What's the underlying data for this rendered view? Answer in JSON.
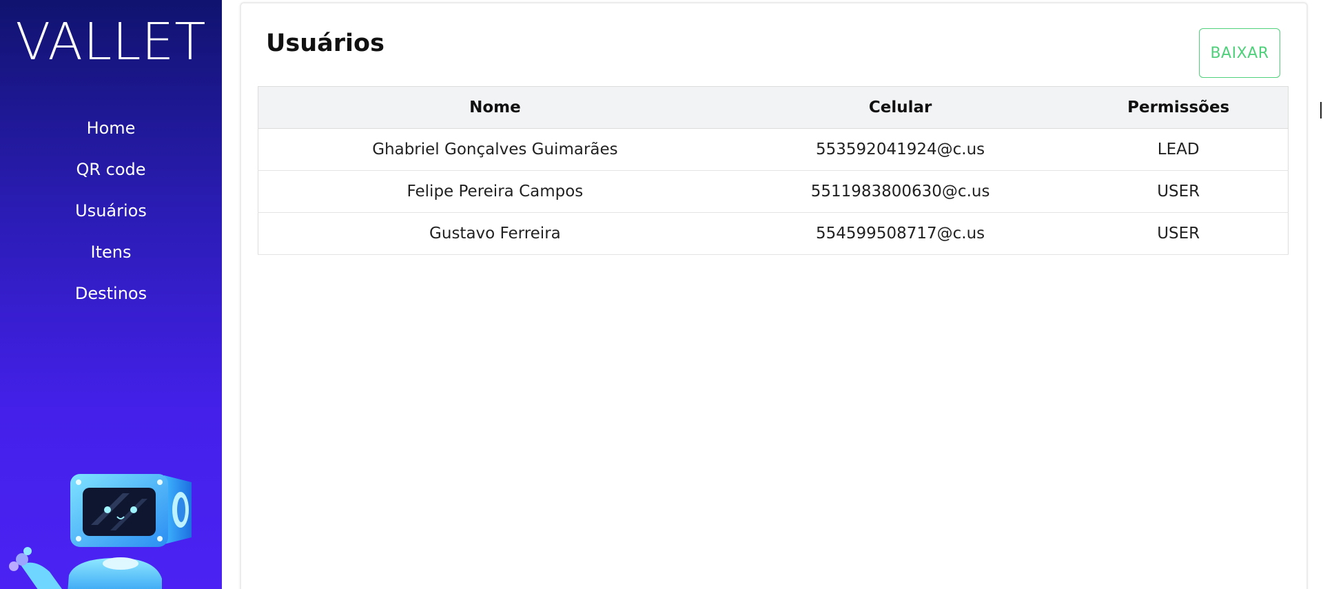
{
  "sidebar": {
    "brand": "VALLET",
    "nav": [
      {
        "label": "Home"
      },
      {
        "label": "QR code"
      },
      {
        "label": "Usuários"
      },
      {
        "label": "Itens"
      },
      {
        "label": "Destinos"
      }
    ]
  },
  "main": {
    "title": "Usuários",
    "download_label": "BAIXAR",
    "table": {
      "headers": [
        "Nome",
        "Celular",
        "Permissões"
      ],
      "rows": [
        [
          "Ghabriel Gonçalves Guimarães",
          "553592041924@c.us",
          "LEAD"
        ],
        [
          "Felipe Pereira Campos",
          "5511983800630@c.us",
          "USER"
        ],
        [
          "Gustavo Ferreira",
          "554599508717@c.us",
          "USER"
        ]
      ]
    }
  },
  "colors": {
    "sidebar_top": "#10136f",
    "sidebar_bottom": "#4b22f3",
    "button_accent": "#4fd07a",
    "header_bg": "#f2f3f5"
  },
  "icons": {
    "mascot": "robot-mascot-icon"
  }
}
